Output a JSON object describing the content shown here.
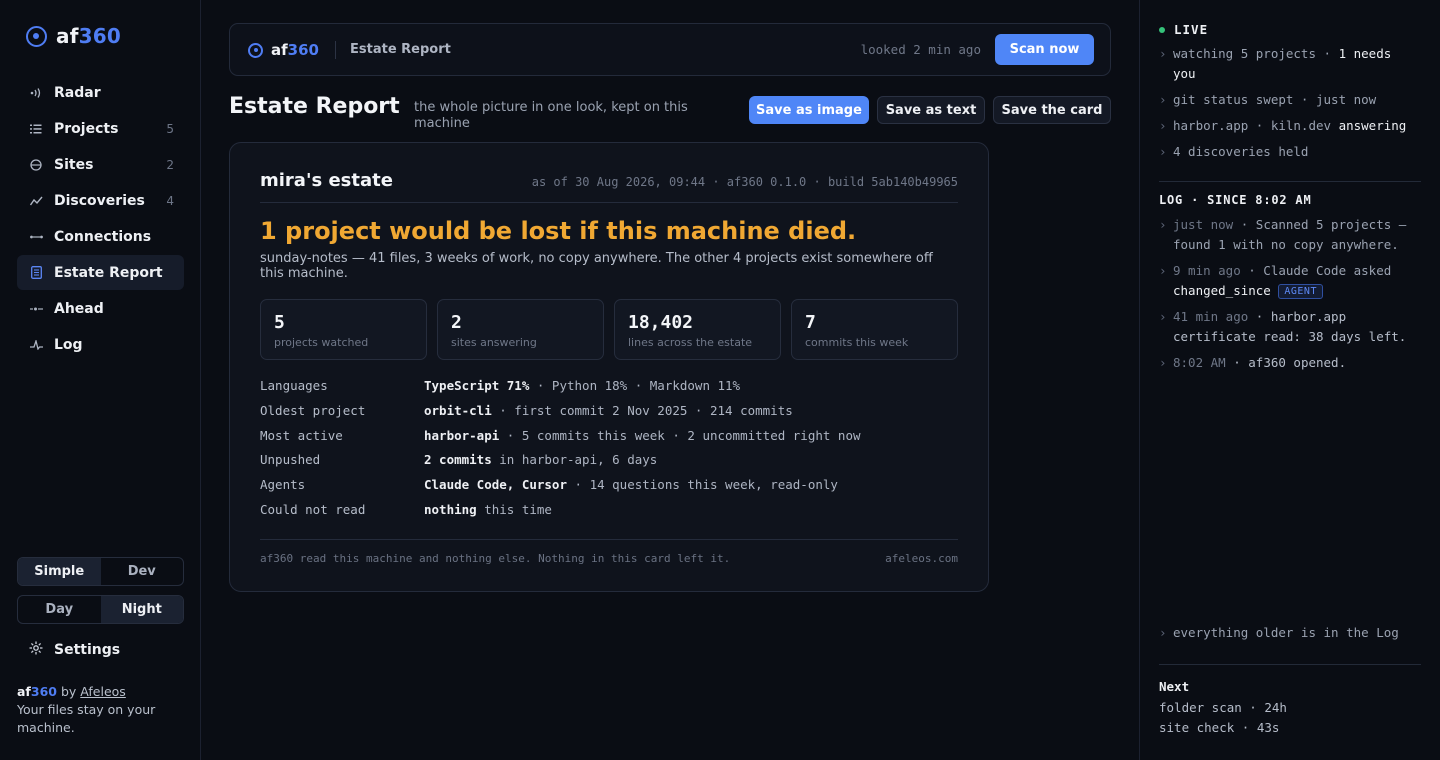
{
  "sidebar": {
    "brand": {
      "prefix": "af",
      "suffix": "360"
    },
    "nav": [
      {
        "label": "Radar",
        "icon": "radar-icon",
        "count": ""
      },
      {
        "label": "Projects",
        "icon": "projects-icon",
        "count": "5"
      },
      {
        "label": "Sites",
        "icon": "sites-icon",
        "count": "2"
      },
      {
        "label": "Discoveries",
        "icon": "discoveries-icon",
        "count": "4"
      },
      {
        "label": "Connections",
        "icon": "connections-icon",
        "count": ""
      },
      {
        "label": "Estate Report",
        "icon": "report-icon",
        "count": "",
        "active": true
      },
      {
        "label": "Ahead",
        "icon": "ahead-icon",
        "count": ""
      },
      {
        "label": "Log",
        "icon": "log-icon",
        "count": ""
      }
    ],
    "mode_toggle": {
      "left": "Simple",
      "right": "Dev",
      "selected": "Simple"
    },
    "theme_toggle": {
      "left": "Day",
      "right": "Night",
      "selected": "Night"
    },
    "settings_label": "Settings",
    "credit": {
      "by": "by",
      "author": "Afeleos",
      "tagline": "Your files stay on your machine."
    }
  },
  "topbar": {
    "brand": {
      "prefix": "af",
      "suffix": "360"
    },
    "title": "Estate Report",
    "looked": "looked 2 min ago",
    "scan_label": "Scan now"
  },
  "page": {
    "title": "Estate Report",
    "subtitle": "the whole picture in one look, kept on this machine",
    "actions": [
      "Save as image",
      "Save as text",
      "Save the card"
    ]
  },
  "card": {
    "owner": "mira's estate",
    "meta": "as of 30 Aug 2026, 09:44 · af360 0.1.0 · build 5ab140b49965",
    "headline": "1 project would be lost if this machine died.",
    "headline_sub": "sunday-notes — 41 files, 3 weeks of work, no copy anywhere. The other 4 projects exist somewhere off this machine.",
    "stats": [
      {
        "value": "5",
        "label": "projects watched"
      },
      {
        "value": "2",
        "label": "sites answering"
      },
      {
        "value": "18,402",
        "label": "lines across the estate"
      },
      {
        "value": "7",
        "label": "commits this week"
      }
    ],
    "facts": [
      {
        "key": "Languages",
        "strong": "TypeScript 71%",
        "rest": " · Python 18% · Markdown 11%"
      },
      {
        "key": "Oldest project",
        "strong": "orbit-cli",
        "rest": " · first commit 2 Nov 2025 · 214 commits"
      },
      {
        "key": "Most active",
        "strong": "harbor-api",
        "rest": " · 5 commits this week · 2 uncommitted right now"
      },
      {
        "key": "Unpushed",
        "strong": "2 commits",
        "rest": " in harbor-api, 6 days"
      },
      {
        "key": "Agents",
        "strong": "Claude Code, Cursor",
        "rest": " · 14 questions this week, read-only"
      },
      {
        "key": "Could not read",
        "strong": "nothing",
        "rest": " this time"
      }
    ],
    "footer_left": "af360 read this machine and nothing else. Nothing in this card left it.",
    "footer_right": "afeleos.com"
  },
  "right_panel": {
    "live_label": "LIVE",
    "live_items": [
      {
        "text": "watching 5 projects · ",
        "strong": "1 needs you"
      },
      {
        "text": "git status swept · just now",
        "strong": ""
      },
      {
        "text": "harbor.app · kiln.dev ",
        "strong": "answering"
      },
      {
        "text": "4 discoveries held",
        "strong": ""
      }
    ],
    "log_label": "LOG · SINCE 8:02 AM",
    "log_items": [
      {
        "time": "just now",
        "text": " · Scanned 5 projects — found 1 with no copy anywhere.",
        "strong": "",
        "badge": ""
      },
      {
        "time": "9 min ago",
        "text": " · Claude Code asked ",
        "strong": "changed_since",
        "badge": "AGENT"
      },
      {
        "time": "41 min ago",
        "text": " · harbor.app certificate read: 38 days left.",
        "strong": "",
        "badge": ""
      },
      {
        "time": "8:02 AM",
        "text": " · af360 opened.",
        "strong": "",
        "badge": ""
      }
    ],
    "older": "everything older is in the Log",
    "next_label": "Next",
    "next_items": [
      "folder scan · 24h",
      "site check · 43s"
    ]
  },
  "colors": {
    "accent": "#4f86f7",
    "warning": "#f0a833",
    "live": "#35c27a",
    "background": "#0a0d14"
  }
}
